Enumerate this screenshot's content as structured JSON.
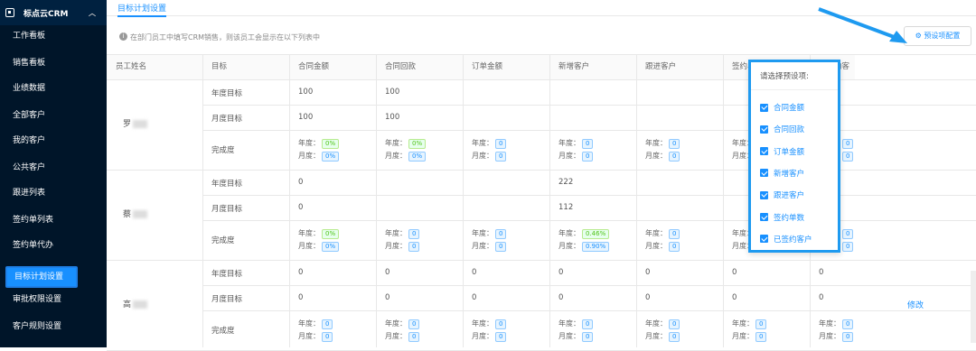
{
  "sidebar": {
    "brand": "标点云CRM",
    "items": [
      {
        "label": "工作看板"
      },
      {
        "label": "销售看板"
      },
      {
        "label": "业绩数据"
      },
      {
        "label": "全部客户"
      },
      {
        "label": "我的客户"
      },
      {
        "label": "公共客户"
      },
      {
        "label": "跟进列表"
      },
      {
        "label": "签约单列表"
      },
      {
        "label": "签约单代办"
      },
      {
        "label": "目标计划设置",
        "active": true
      },
      {
        "label": "审批权限设置"
      },
      {
        "label": "客户规则设置"
      }
    ]
  },
  "tab": "目标计划设置",
  "info": "在部门员工中填写CRM销售，则该员工会显示在以下列表中",
  "config_button": "预设项配置",
  "headers": [
    "员工姓名",
    "目标",
    "合同金额",
    "合同回款",
    "订单金额",
    "新增客户",
    "跟进客户",
    "签约单数",
    "已签约客户"
  ],
  "rows": [
    {
      "name": "罗",
      "annual": [
        "100",
        "100",
        "",
        "",
        "",
        "",
        ""
      ],
      "monthly": [
        "100",
        "100",
        "",
        "",
        "",
        "",
        ""
      ],
      "progress": [
        [
          "0%",
          "0%"
        ],
        [
          "0%",
          "0%"
        ],
        [
          "0",
          "0"
        ],
        [
          "0",
          "0"
        ],
        [
          "0",
          "0"
        ],
        [
          "0",
          "0"
        ],
        [
          "0",
          "0"
        ]
      ]
    },
    {
      "name": "蔡",
      "annual": [
        "0",
        "",
        "",
        "222",
        "",
        "",
        ""
      ],
      "monthly": [
        "0",
        "",
        "",
        "112",
        "",
        "",
        ""
      ],
      "progress": [
        [
          "0%",
          "0%"
        ],
        [
          "0",
          "0"
        ],
        [
          "0",
          "0"
        ],
        [
          "0.46%",
          "0.90%"
        ],
        [
          "0",
          "0"
        ],
        [
          "0",
          "0"
        ],
        [
          "0",
          "0"
        ]
      ]
    },
    {
      "name": "高",
      "annual": [
        "0",
        "0",
        "0",
        "0",
        "0",
        "0",
        "0"
      ],
      "monthly": [
        "0",
        "0",
        "0",
        "0",
        "0",
        "0",
        "0"
      ],
      "progress": [
        [
          "0",
          "0"
        ],
        [
          "0",
          "0"
        ],
        [
          "0",
          "0"
        ],
        [
          "0",
          "0"
        ],
        [
          "0",
          "0"
        ],
        [
          "0",
          "0"
        ],
        [
          "0",
          "0"
        ]
      ]
    }
  ],
  "labels": {
    "annual": "年度目标",
    "monthly": "月度目标",
    "completion": "完成度",
    "year": "年度：",
    "month": "月度："
  },
  "edit": "修改",
  "popup": {
    "title": "请选择预设项:",
    "items": [
      "合同金额",
      "合同回款",
      "订单金额",
      "新增客户",
      "跟进客户",
      "签约单数",
      "已签约客户"
    ]
  },
  "colors": {
    "accent": "#1890ff",
    "sidebar": "#001529",
    "highlight": "#1e9af0"
  }
}
